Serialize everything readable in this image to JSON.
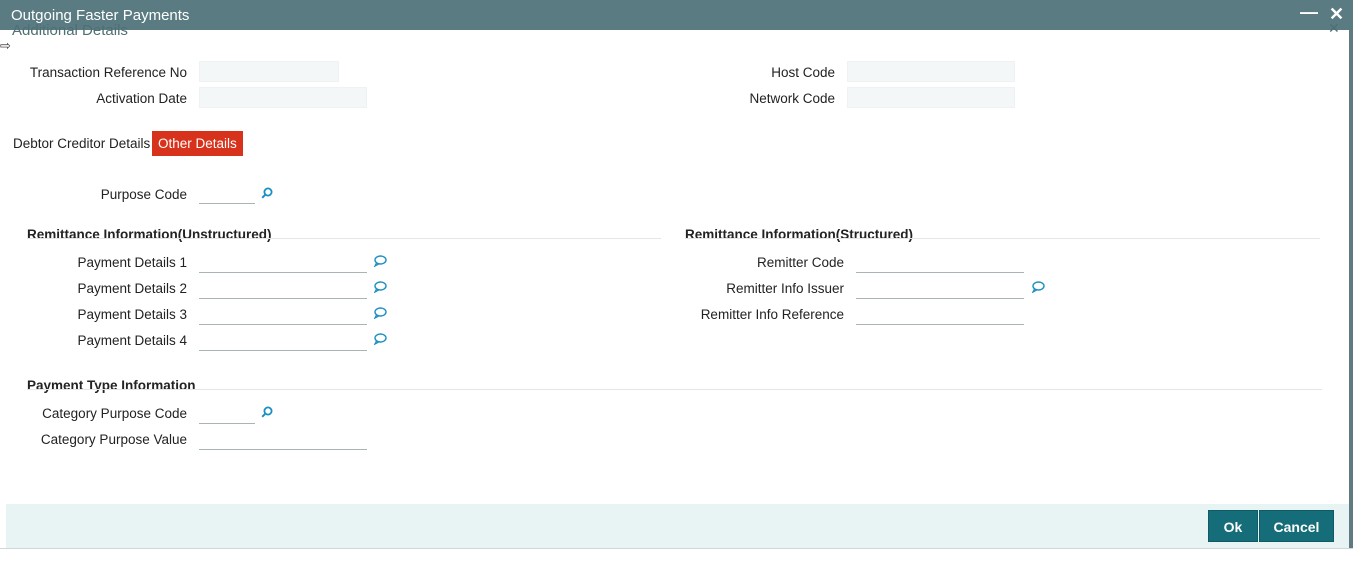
{
  "window": {
    "title": "Outgoing Faster Payments",
    "section_title": "Additional Details"
  },
  "header_fields": {
    "txn_ref_label": "Transaction Reference No",
    "activation_date_label": "Activation Date",
    "host_code_label": "Host Code",
    "network_code_label": "Network Code"
  },
  "tabs": [
    {
      "label": "Debtor Creditor Details",
      "active": false
    },
    {
      "label": "Other Details",
      "active": true
    }
  ],
  "purpose": {
    "label": "Purpose Code"
  },
  "remittance_unstructured": {
    "title": "Remittance Information(Unstructured)",
    "fields": [
      {
        "label": "Payment Details 1"
      },
      {
        "label": "Payment Details 2"
      },
      {
        "label": "Payment Details 3"
      },
      {
        "label": "Payment Details 4"
      }
    ]
  },
  "remittance_structured": {
    "title": "Remittance Information(Structured)",
    "fields": [
      {
        "label": "Remitter Code"
      },
      {
        "label": "Remitter Info Issuer"
      },
      {
        "label": "Remitter Info Reference"
      }
    ]
  },
  "payment_type": {
    "title": "Payment Type Information",
    "category_code_label": "Category Purpose Code",
    "category_value_label": "Category Purpose Value"
  },
  "buttons": {
    "ok": "Ok",
    "cancel": "Cancel"
  },
  "colors": {
    "titlebar": "#5a7b81",
    "active_tab": "#d7321b",
    "button": "#146d78",
    "icon": "#1a8fc2"
  }
}
